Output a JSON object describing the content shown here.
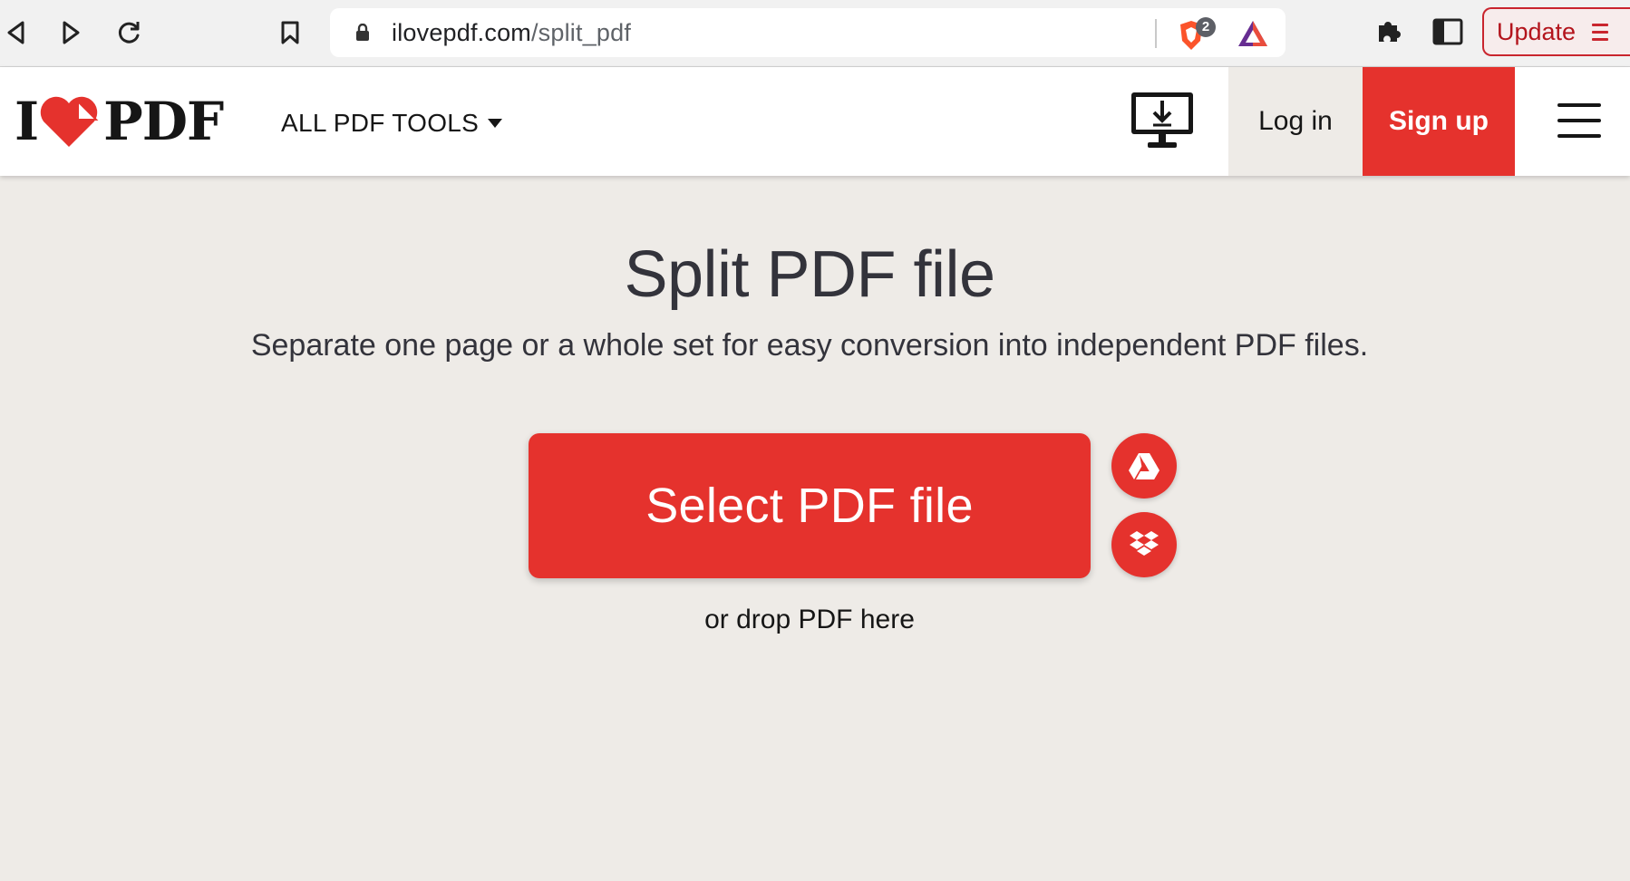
{
  "browser": {
    "url_host": "ilovepdf.com",
    "url_path": "/split_pdf",
    "shield_count": "2",
    "update_label": "Update"
  },
  "header": {
    "logo_text_left": "I",
    "logo_text_right": "PDF",
    "all_tools_label": "ALL PDF TOOLS",
    "login_label": "Log in",
    "signup_label": "Sign up"
  },
  "main": {
    "title": "Split PDF file",
    "subtitle": "Separate one page or a whole set for easy conversion into independent PDF files.",
    "select_button_label": "Select PDF file",
    "drop_hint": "or drop PDF here"
  },
  "colors": {
    "brand_red": "#e5322d",
    "page_background": "#eeebe7",
    "text_dark": "#33333b"
  },
  "icons": [
    "back-icon",
    "forward-icon",
    "reload-icon",
    "bookmark-icon",
    "lock-icon",
    "brave-shield-icon",
    "brave-rewards-icon",
    "extensions-icon",
    "sidebar-icon",
    "menu-icon",
    "desktop-download-icon",
    "hamburger-icon",
    "google-drive-icon",
    "dropbox-icon"
  ]
}
